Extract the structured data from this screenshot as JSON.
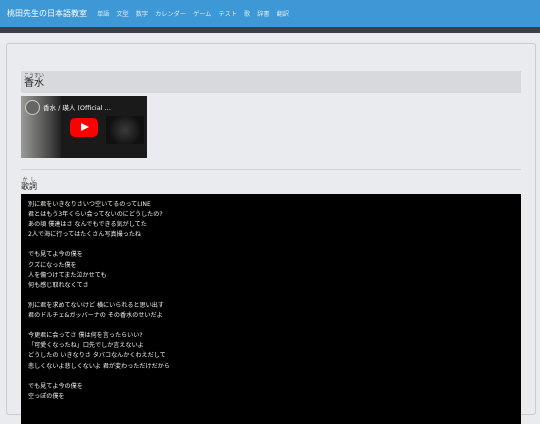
{
  "header": {
    "brand": "桃田先生の日本語教室",
    "nav": [
      "単語",
      "文型",
      "数字",
      "カレンダー",
      "ゲーム",
      "テスト",
      "歌",
      "辞書",
      "翻訳"
    ]
  },
  "song": {
    "title": "香水",
    "title_ruby": "こうすい",
    "video_title": "香水 / 瑛人 (Official ..."
  },
  "lyrics": {
    "label": "歌詞",
    "label_ruby": "かし",
    "lines": [
      "別に君をいきなりさいつ空いてるのってLINE",
      "君とはもう3年くらい会ってないのにどうしたの?",
      "あの頃 僕達はさ なんでもできる気がしてた",
      "2人で海に行ってはたくさん写真撮ったね",
      "",
      "でも見てよ今の僕を",
      "クズになった僕を",
      "人を傷つけてまた泣かせても",
      "何も感じ取れなくてさ",
      "",
      "別に君を求めてないけど 横にいられると思い出す",
      "君のドルチェ&ガッバーナの その香水のせいだよ",
      "",
      "今更君に会ってさ 僕は何を言ったらいい?",
      "「可愛くなったね」口先でしか言えないよ",
      "どうしたの いきなりさ タバコなんかくわえだして",
      "悲しくないよ悲しくないよ 君が変わっただけだから",
      "",
      "でも見てよ今の僕を",
      "空っぽの僕を"
    ]
  }
}
